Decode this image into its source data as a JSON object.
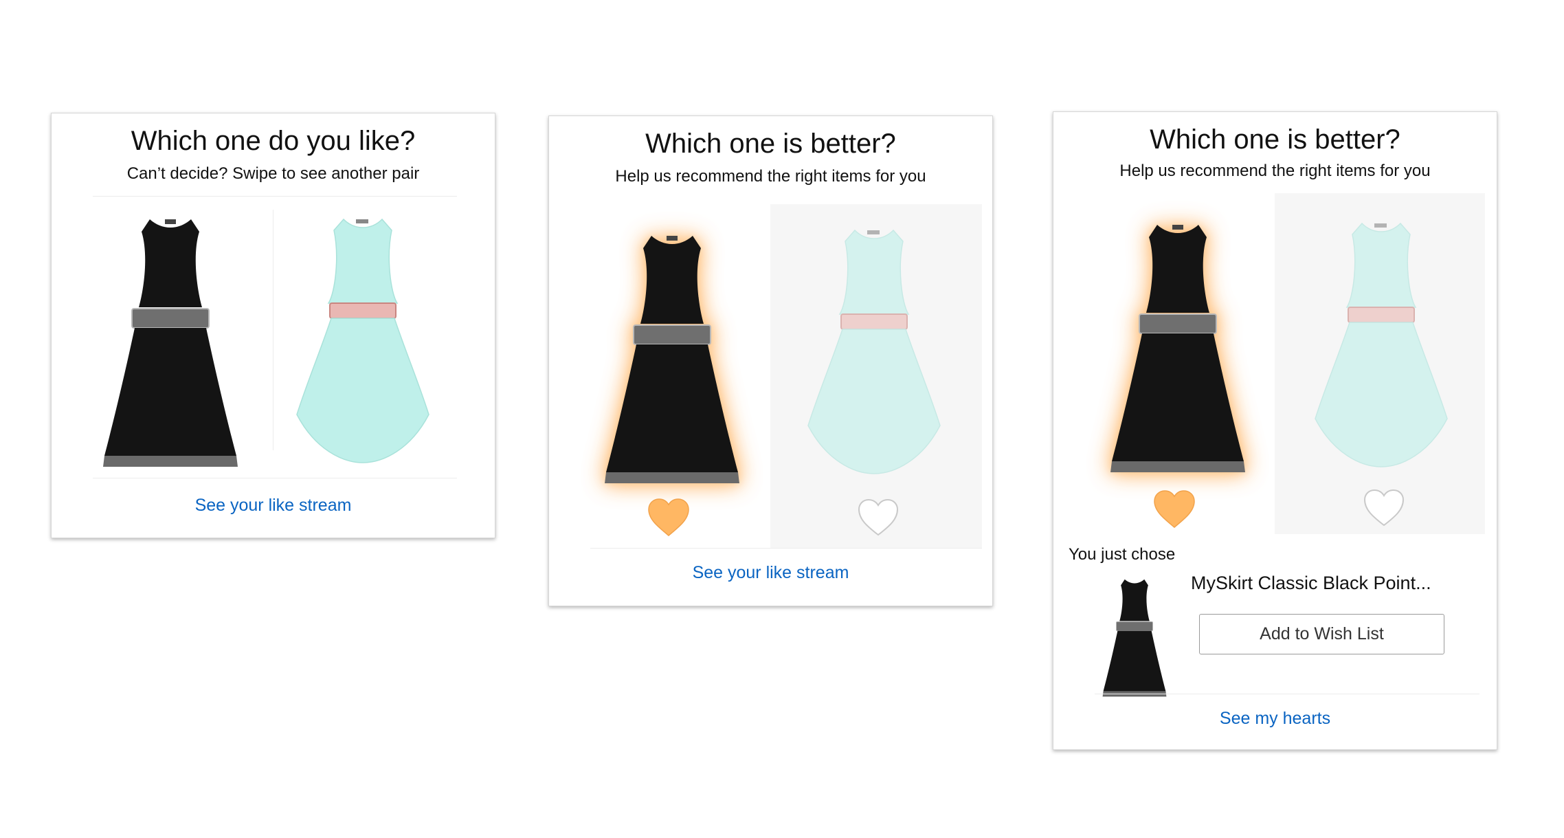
{
  "colors": {
    "link": "#0a64c2",
    "heart_selected": "#ffb763",
    "heart_outline": "#c9c9c9",
    "black_dress": "#141414",
    "mint_dress": "#bff0ea",
    "belt_black": "#6f6f6f",
    "belt_mint": "#e9b7b3"
  },
  "cards": [
    {
      "title": "Which one do you like?",
      "subtitle": "Can’t decide? Swipe to see another pair",
      "left_item": {
        "name": "black dress",
        "icon": "black-dress-image"
      },
      "right_item": {
        "name": "mint dress",
        "icon": "mint-dress-image"
      },
      "footer_link": "See your like stream"
    },
    {
      "title": "Which one is better?",
      "subtitle": "Help us recommend the right items for you",
      "left_item": {
        "name": "black dress",
        "icon": "black-dress-image",
        "hearted": true
      },
      "right_item": {
        "name": "mint dress",
        "icon": "mint-dress-image",
        "hearted": false
      },
      "footer_link": "See your like stream"
    },
    {
      "title": "Which one is better?",
      "subtitle": "Help us recommend the right items for you",
      "left_item": {
        "name": "black dress",
        "icon": "black-dress-image",
        "hearted": true
      },
      "right_item": {
        "name": "mint dress",
        "icon": "mint-dress-image",
        "hearted": false
      },
      "chosen": {
        "label": "You just chose",
        "product_name": "MySkirt Classic Black Point...",
        "button_label": "Add to Wish List"
      },
      "footer_link": "See my hearts"
    }
  ]
}
